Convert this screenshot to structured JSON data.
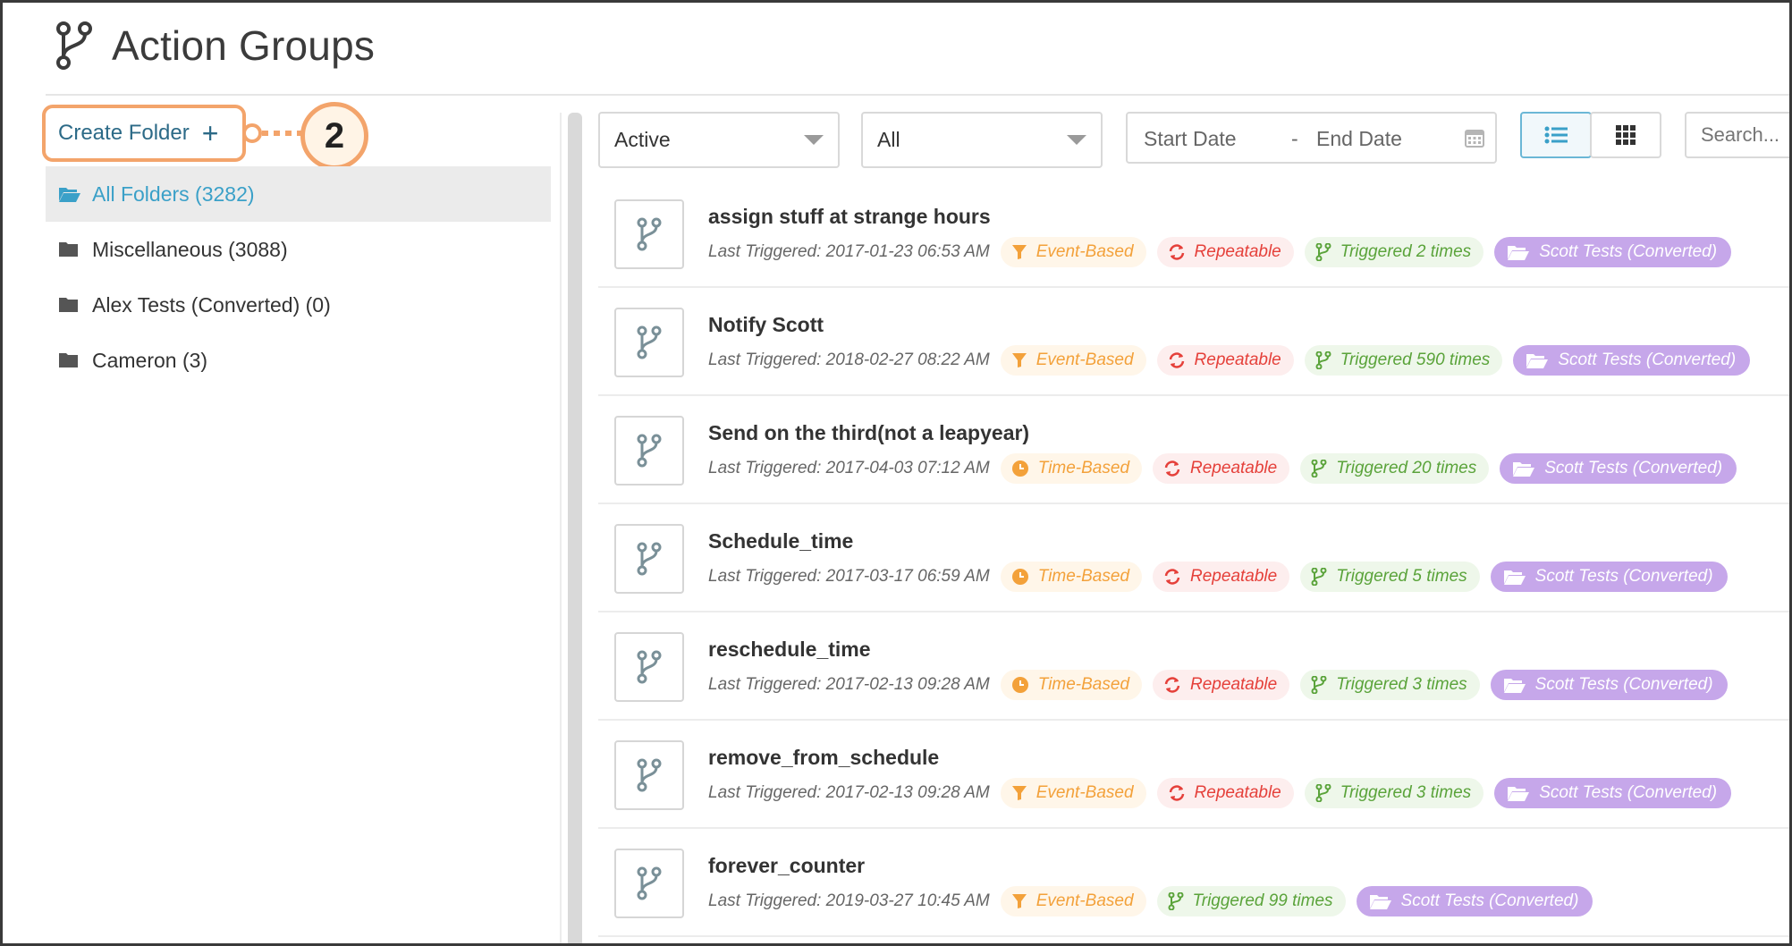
{
  "header": {
    "title": "Action Groups",
    "icon": "branch-icon"
  },
  "sidebar": {
    "create_folder_label": "Create Folder",
    "create_folder_plus": "+",
    "step_badge": "2",
    "folders": [
      {
        "label": "All Folders (3282)",
        "active": true
      },
      {
        "label": "Miscellaneous (3088)",
        "active": false
      },
      {
        "label": "Alex Tests (Converted) (0)",
        "active": false
      },
      {
        "label": "Cameron (3)",
        "active": false
      }
    ]
  },
  "toolbar": {
    "status_select": "Active",
    "type_select": "All",
    "start_date_placeholder": "Start Date",
    "date_separator": "-",
    "end_date_placeholder": "End Date",
    "search_placeholder": "Search..."
  },
  "colors": {
    "accent": "#3aa0c8",
    "callout": "#f3a46b",
    "event_tag": "#f3a13a",
    "repeat_tag": "#e5403a",
    "triggered_tag": "#5aa33a",
    "folder_tag": "#c6a7ea"
  },
  "rows": [
    {
      "title": "assign stuff at strange hours",
      "last": "Last Triggered: 2017-01-23 06:53 AM",
      "type": "Event-Based",
      "type_kind": "event",
      "repeat": "Repeatable",
      "triggered": "Triggered 2 times",
      "folder": "Scott Tests (Converted)"
    },
    {
      "title": "Notify Scott",
      "last": "Last Triggered: 2018-02-27 08:22 AM",
      "type": "Event-Based",
      "type_kind": "event",
      "repeat": "Repeatable",
      "triggered": "Triggered 590 times",
      "folder": "Scott Tests (Converted)"
    },
    {
      "title": "Send on the third(not a leapyear)",
      "last": "Last Triggered: 2017-04-03 07:12 AM",
      "type": "Time-Based",
      "type_kind": "time",
      "repeat": "Repeatable",
      "triggered": "Triggered 20 times",
      "folder": "Scott Tests (Converted)"
    },
    {
      "title": "Schedule_time",
      "last": "Last Triggered: 2017-03-17 06:59 AM",
      "type": "Time-Based",
      "type_kind": "time",
      "repeat": "Repeatable",
      "triggered": "Triggered 5 times",
      "folder": "Scott Tests (Converted)"
    },
    {
      "title": "reschedule_time",
      "last": "Last Triggered: 2017-02-13 09:28 AM",
      "type": "Time-Based",
      "type_kind": "time",
      "repeat": "Repeatable",
      "triggered": "Triggered 3 times",
      "folder": "Scott Tests (Converted)"
    },
    {
      "title": "remove_from_schedule",
      "last": "Last Triggered: 2017-02-13 09:28 AM",
      "type": "Event-Based",
      "type_kind": "event",
      "repeat": "Repeatable",
      "triggered": "Triggered 3 times",
      "folder": "Scott Tests (Converted)"
    },
    {
      "title": "forever_counter",
      "last": "Last Triggered: 2019-03-27 10:45 AM",
      "type": "Event-Based",
      "type_kind": "event",
      "repeat": null,
      "triggered": "Triggered 99 times",
      "folder": "Scott Tests (Converted)"
    }
  ]
}
